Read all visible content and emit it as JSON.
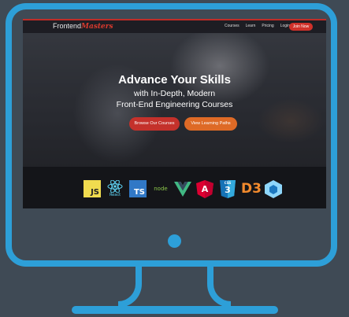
{
  "nav": {
    "logo_prefix": "Frontend",
    "logo_suffix": "Masters",
    "links": [
      "Courses",
      "Learn",
      "Pricing",
      "Login"
    ],
    "join_label": "Join Now"
  },
  "hero": {
    "headline": "Advance Your Skills",
    "subline_1": "with In-Depth, Modern",
    "subline_2": "Front-End Engineering Courses",
    "browse_label": "Browse Our Courses",
    "paths_label": "View Learning Paths"
  },
  "tech_logos": {
    "js": "JS",
    "react": "React",
    "ts": "TS",
    "node": "node",
    "angular": "A",
    "css": "CSS",
    "css_num": "3",
    "d3": "D3"
  },
  "colors": {
    "monitor": "#2d9fd8",
    "brand_red": "#d0312a",
    "accent_orange": "#de6a26"
  }
}
